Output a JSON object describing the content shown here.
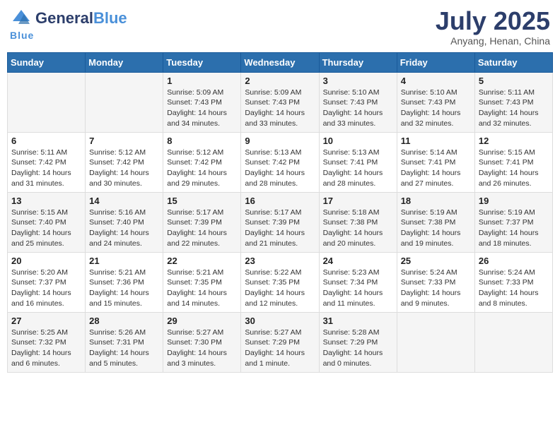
{
  "header": {
    "logo_general": "General",
    "logo_blue": "Blue",
    "month_title": "July 2025",
    "location": "Anyang, Henan, China"
  },
  "weekdays": [
    "Sunday",
    "Monday",
    "Tuesday",
    "Wednesday",
    "Thursday",
    "Friday",
    "Saturday"
  ],
  "weeks": [
    [
      {
        "day": "",
        "detail": ""
      },
      {
        "day": "",
        "detail": ""
      },
      {
        "day": "1",
        "detail": "Sunrise: 5:09 AM\nSunset: 7:43 PM\nDaylight: 14 hours\nand 34 minutes."
      },
      {
        "day": "2",
        "detail": "Sunrise: 5:09 AM\nSunset: 7:43 PM\nDaylight: 14 hours\nand 33 minutes."
      },
      {
        "day": "3",
        "detail": "Sunrise: 5:10 AM\nSunset: 7:43 PM\nDaylight: 14 hours\nand 33 minutes."
      },
      {
        "day": "4",
        "detail": "Sunrise: 5:10 AM\nSunset: 7:43 PM\nDaylight: 14 hours\nand 32 minutes."
      },
      {
        "day": "5",
        "detail": "Sunrise: 5:11 AM\nSunset: 7:43 PM\nDaylight: 14 hours\nand 32 minutes."
      }
    ],
    [
      {
        "day": "6",
        "detail": "Sunrise: 5:11 AM\nSunset: 7:42 PM\nDaylight: 14 hours\nand 31 minutes."
      },
      {
        "day": "7",
        "detail": "Sunrise: 5:12 AM\nSunset: 7:42 PM\nDaylight: 14 hours\nand 30 minutes."
      },
      {
        "day": "8",
        "detail": "Sunrise: 5:12 AM\nSunset: 7:42 PM\nDaylight: 14 hours\nand 29 minutes."
      },
      {
        "day": "9",
        "detail": "Sunrise: 5:13 AM\nSunset: 7:42 PM\nDaylight: 14 hours\nand 28 minutes."
      },
      {
        "day": "10",
        "detail": "Sunrise: 5:13 AM\nSunset: 7:41 PM\nDaylight: 14 hours\nand 28 minutes."
      },
      {
        "day": "11",
        "detail": "Sunrise: 5:14 AM\nSunset: 7:41 PM\nDaylight: 14 hours\nand 27 minutes."
      },
      {
        "day": "12",
        "detail": "Sunrise: 5:15 AM\nSunset: 7:41 PM\nDaylight: 14 hours\nand 26 minutes."
      }
    ],
    [
      {
        "day": "13",
        "detail": "Sunrise: 5:15 AM\nSunset: 7:40 PM\nDaylight: 14 hours\nand 25 minutes."
      },
      {
        "day": "14",
        "detail": "Sunrise: 5:16 AM\nSunset: 7:40 PM\nDaylight: 14 hours\nand 24 minutes."
      },
      {
        "day": "15",
        "detail": "Sunrise: 5:17 AM\nSunset: 7:39 PM\nDaylight: 14 hours\nand 22 minutes."
      },
      {
        "day": "16",
        "detail": "Sunrise: 5:17 AM\nSunset: 7:39 PM\nDaylight: 14 hours\nand 21 minutes."
      },
      {
        "day": "17",
        "detail": "Sunrise: 5:18 AM\nSunset: 7:38 PM\nDaylight: 14 hours\nand 20 minutes."
      },
      {
        "day": "18",
        "detail": "Sunrise: 5:19 AM\nSunset: 7:38 PM\nDaylight: 14 hours\nand 19 minutes."
      },
      {
        "day": "19",
        "detail": "Sunrise: 5:19 AM\nSunset: 7:37 PM\nDaylight: 14 hours\nand 18 minutes."
      }
    ],
    [
      {
        "day": "20",
        "detail": "Sunrise: 5:20 AM\nSunset: 7:37 PM\nDaylight: 14 hours\nand 16 minutes."
      },
      {
        "day": "21",
        "detail": "Sunrise: 5:21 AM\nSunset: 7:36 PM\nDaylight: 14 hours\nand 15 minutes."
      },
      {
        "day": "22",
        "detail": "Sunrise: 5:21 AM\nSunset: 7:35 PM\nDaylight: 14 hours\nand 14 minutes."
      },
      {
        "day": "23",
        "detail": "Sunrise: 5:22 AM\nSunset: 7:35 PM\nDaylight: 14 hours\nand 12 minutes."
      },
      {
        "day": "24",
        "detail": "Sunrise: 5:23 AM\nSunset: 7:34 PM\nDaylight: 14 hours\nand 11 minutes."
      },
      {
        "day": "25",
        "detail": "Sunrise: 5:24 AM\nSunset: 7:33 PM\nDaylight: 14 hours\nand 9 minutes."
      },
      {
        "day": "26",
        "detail": "Sunrise: 5:24 AM\nSunset: 7:33 PM\nDaylight: 14 hours\nand 8 minutes."
      }
    ],
    [
      {
        "day": "27",
        "detail": "Sunrise: 5:25 AM\nSunset: 7:32 PM\nDaylight: 14 hours\nand 6 minutes."
      },
      {
        "day": "28",
        "detail": "Sunrise: 5:26 AM\nSunset: 7:31 PM\nDaylight: 14 hours\nand 5 minutes."
      },
      {
        "day": "29",
        "detail": "Sunrise: 5:27 AM\nSunset: 7:30 PM\nDaylight: 14 hours\nand 3 minutes."
      },
      {
        "day": "30",
        "detail": "Sunrise: 5:27 AM\nSunset: 7:29 PM\nDaylight: 14 hours\nand 1 minute."
      },
      {
        "day": "31",
        "detail": "Sunrise: 5:28 AM\nSunset: 7:29 PM\nDaylight: 14 hours\nand 0 minutes."
      },
      {
        "day": "",
        "detail": ""
      },
      {
        "day": "",
        "detail": ""
      }
    ]
  ]
}
